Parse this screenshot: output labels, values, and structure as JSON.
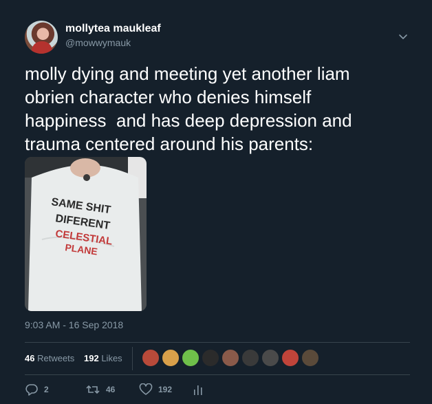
{
  "user": {
    "display_name": "mollytea maukleaf",
    "handle": "@mowwymauk"
  },
  "tweet": {
    "text": "molly dying and meeting yet another liam\nobrien character who denies himself\nhappiness  and has deep depression and\ntrauma centered around his parents:",
    "media_shirt_text": [
      "SAME SHIT",
      "DIFERENT",
      "CELESTIAL",
      "PLANE"
    ],
    "timestamp": "9:03 AM - 16 Sep 2018"
  },
  "stats": {
    "retweets_count": "46",
    "retweets_label": "Retweets",
    "likes_count": "192",
    "likes_label": "Likes"
  },
  "actions": {
    "replies": "2",
    "retweets": "46",
    "likes": "192"
  },
  "likers": [
    {
      "color": "#b84a3a"
    },
    {
      "color": "#d9a04a"
    },
    {
      "color": "#6fbf4a"
    },
    {
      "color": "#2b2b2b"
    },
    {
      "color": "#8a5a4a"
    },
    {
      "color": "#3a3a3a"
    },
    {
      "color": "#4a4a4a"
    },
    {
      "color": "#c0443a"
    },
    {
      "color": "#5a4a3a"
    }
  ],
  "colors": {
    "background": "#15202b",
    "secondary_text": "#8899a6",
    "divider": "#38444d",
    "shirt_text_red": "#c23a3a"
  }
}
